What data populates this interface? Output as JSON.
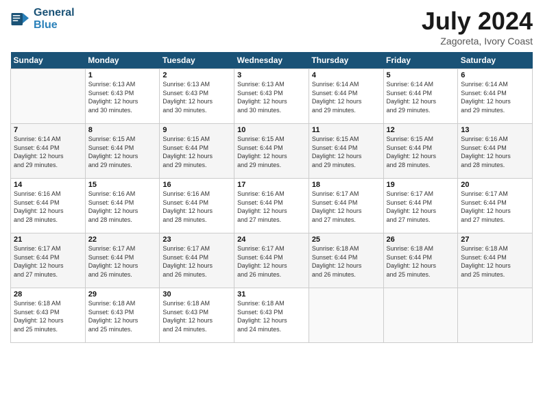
{
  "header": {
    "logo_line1": "General",
    "logo_line2": "Blue",
    "month_title": "July 2024",
    "location": "Zagoreta, Ivory Coast"
  },
  "days_of_week": [
    "Sunday",
    "Monday",
    "Tuesday",
    "Wednesday",
    "Thursday",
    "Friday",
    "Saturday"
  ],
  "weeks": [
    [
      {
        "day": "",
        "info": ""
      },
      {
        "day": "1",
        "info": "Sunrise: 6:13 AM\nSunset: 6:43 PM\nDaylight: 12 hours\nand 30 minutes."
      },
      {
        "day": "2",
        "info": "Sunrise: 6:13 AM\nSunset: 6:43 PM\nDaylight: 12 hours\nand 30 minutes."
      },
      {
        "day": "3",
        "info": "Sunrise: 6:13 AM\nSunset: 6:43 PM\nDaylight: 12 hours\nand 30 minutes."
      },
      {
        "day": "4",
        "info": "Sunrise: 6:14 AM\nSunset: 6:44 PM\nDaylight: 12 hours\nand 29 minutes."
      },
      {
        "day": "5",
        "info": "Sunrise: 6:14 AM\nSunset: 6:44 PM\nDaylight: 12 hours\nand 29 minutes."
      },
      {
        "day": "6",
        "info": "Sunrise: 6:14 AM\nSunset: 6:44 PM\nDaylight: 12 hours\nand 29 minutes."
      }
    ],
    [
      {
        "day": "7",
        "info": "Sunrise: 6:14 AM\nSunset: 6:44 PM\nDaylight: 12 hours\nand 29 minutes."
      },
      {
        "day": "8",
        "info": "Sunrise: 6:15 AM\nSunset: 6:44 PM\nDaylight: 12 hours\nand 29 minutes."
      },
      {
        "day": "9",
        "info": "Sunrise: 6:15 AM\nSunset: 6:44 PM\nDaylight: 12 hours\nand 29 minutes."
      },
      {
        "day": "10",
        "info": "Sunrise: 6:15 AM\nSunset: 6:44 PM\nDaylight: 12 hours\nand 29 minutes."
      },
      {
        "day": "11",
        "info": "Sunrise: 6:15 AM\nSunset: 6:44 PM\nDaylight: 12 hours\nand 29 minutes."
      },
      {
        "day": "12",
        "info": "Sunrise: 6:15 AM\nSunset: 6:44 PM\nDaylight: 12 hours\nand 28 minutes."
      },
      {
        "day": "13",
        "info": "Sunrise: 6:16 AM\nSunset: 6:44 PM\nDaylight: 12 hours\nand 28 minutes."
      }
    ],
    [
      {
        "day": "14",
        "info": "Sunrise: 6:16 AM\nSunset: 6:44 PM\nDaylight: 12 hours\nand 28 minutes."
      },
      {
        "day": "15",
        "info": "Sunrise: 6:16 AM\nSunset: 6:44 PM\nDaylight: 12 hours\nand 28 minutes."
      },
      {
        "day": "16",
        "info": "Sunrise: 6:16 AM\nSunset: 6:44 PM\nDaylight: 12 hours\nand 28 minutes."
      },
      {
        "day": "17",
        "info": "Sunrise: 6:16 AM\nSunset: 6:44 PM\nDaylight: 12 hours\nand 27 minutes."
      },
      {
        "day": "18",
        "info": "Sunrise: 6:17 AM\nSunset: 6:44 PM\nDaylight: 12 hours\nand 27 minutes."
      },
      {
        "day": "19",
        "info": "Sunrise: 6:17 AM\nSunset: 6:44 PM\nDaylight: 12 hours\nand 27 minutes."
      },
      {
        "day": "20",
        "info": "Sunrise: 6:17 AM\nSunset: 6:44 PM\nDaylight: 12 hours\nand 27 minutes."
      }
    ],
    [
      {
        "day": "21",
        "info": "Sunrise: 6:17 AM\nSunset: 6:44 PM\nDaylight: 12 hours\nand 27 minutes."
      },
      {
        "day": "22",
        "info": "Sunrise: 6:17 AM\nSunset: 6:44 PM\nDaylight: 12 hours\nand 26 minutes."
      },
      {
        "day": "23",
        "info": "Sunrise: 6:17 AM\nSunset: 6:44 PM\nDaylight: 12 hours\nand 26 minutes."
      },
      {
        "day": "24",
        "info": "Sunrise: 6:17 AM\nSunset: 6:44 PM\nDaylight: 12 hours\nand 26 minutes."
      },
      {
        "day": "25",
        "info": "Sunrise: 6:18 AM\nSunset: 6:44 PM\nDaylight: 12 hours\nand 26 minutes."
      },
      {
        "day": "26",
        "info": "Sunrise: 6:18 AM\nSunset: 6:44 PM\nDaylight: 12 hours\nand 25 minutes."
      },
      {
        "day": "27",
        "info": "Sunrise: 6:18 AM\nSunset: 6:44 PM\nDaylight: 12 hours\nand 25 minutes."
      }
    ],
    [
      {
        "day": "28",
        "info": "Sunrise: 6:18 AM\nSunset: 6:43 PM\nDaylight: 12 hours\nand 25 minutes."
      },
      {
        "day": "29",
        "info": "Sunrise: 6:18 AM\nSunset: 6:43 PM\nDaylight: 12 hours\nand 25 minutes."
      },
      {
        "day": "30",
        "info": "Sunrise: 6:18 AM\nSunset: 6:43 PM\nDaylight: 12 hours\nand 24 minutes."
      },
      {
        "day": "31",
        "info": "Sunrise: 6:18 AM\nSunset: 6:43 PM\nDaylight: 12 hours\nand 24 minutes."
      },
      {
        "day": "",
        "info": ""
      },
      {
        "day": "",
        "info": ""
      },
      {
        "day": "",
        "info": ""
      }
    ]
  ]
}
